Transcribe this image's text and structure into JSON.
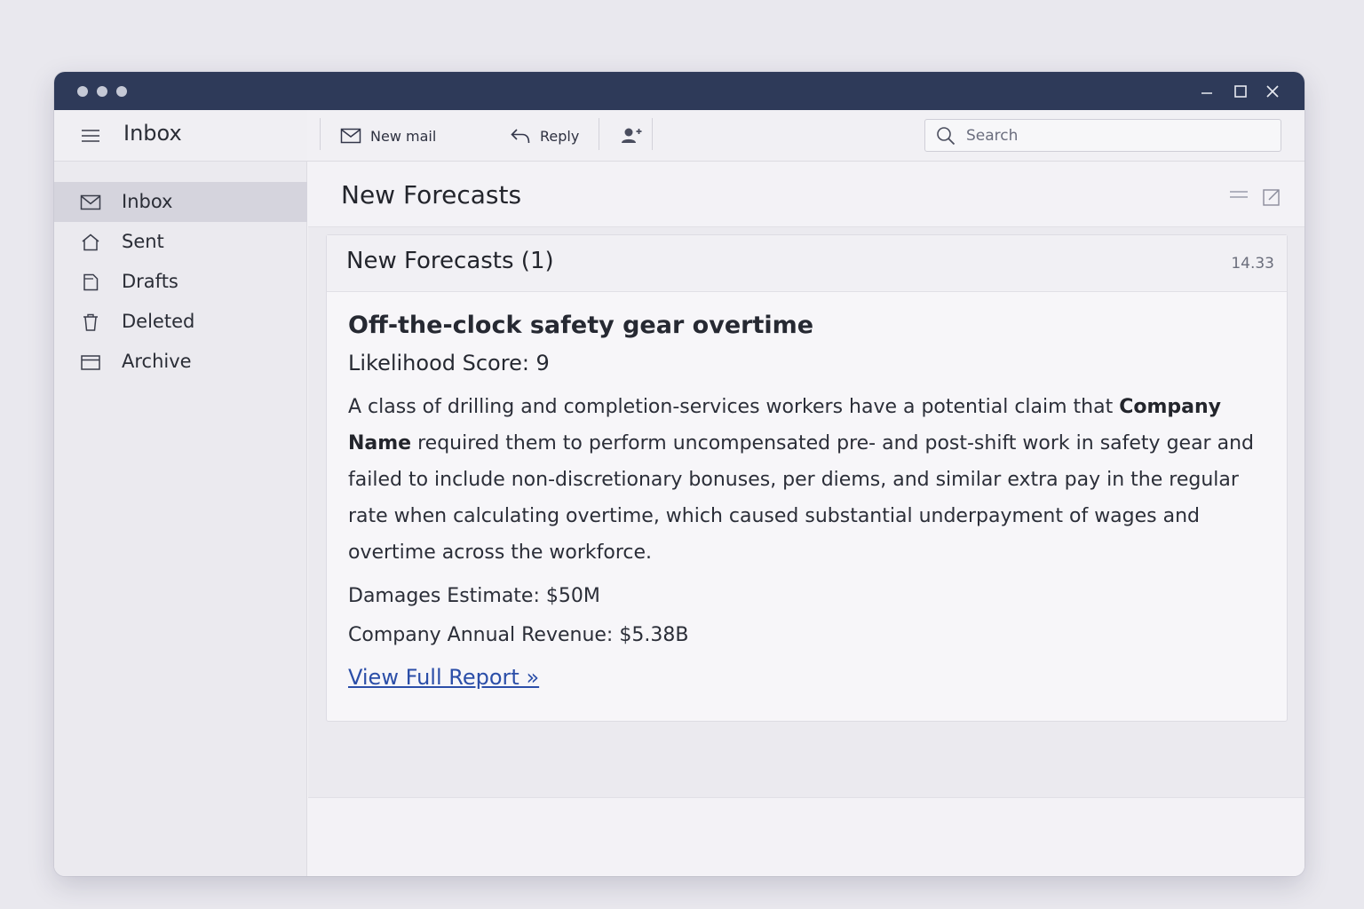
{
  "titlebar": {
    "dots": [
      "dot",
      "dot",
      "dot"
    ],
    "controls": [
      "minimize-icon",
      "maximize-icon",
      "close-icon"
    ]
  },
  "sidebar": {
    "title": "Inbox",
    "items": [
      {
        "label": "Inbox",
        "icon": "envelope-icon",
        "active": true
      },
      {
        "label": "Sent",
        "icon": "home-icon",
        "active": false
      },
      {
        "label": "Drafts",
        "icon": "document-icon",
        "active": false
      },
      {
        "label": "Deleted",
        "icon": "trash-icon",
        "active": false
      },
      {
        "label": "Archive",
        "icon": "archive-icon",
        "active": false
      }
    ]
  },
  "toolbar": {
    "new_mail_label": "New mail",
    "reply_label": "Reply"
  },
  "search": {
    "placeholder": "Search"
  },
  "folder": {
    "title": "New Forecasts"
  },
  "message": {
    "subject": "New Forecasts (1)",
    "time": "14.33",
    "title": "Off-the-clock safety gear overtime",
    "likelihood": "Likelihood Score: 9",
    "para_start": "A class of drilling and completion-services workers have a potential claim that",
    "company": "Company Name",
    "para_rest": "required them to perform uncompensated pre- and post-shift work in safety gear and failed to include non-discretionary bonuses, per diems, and similar extra pay in the regular rate when calculating overtime, which caused substantial underpayment of wages and overtime across the workforce.",
    "damages": "Damages Estimate: $50M",
    "revenue": "Company Annual Revenue: $5.38B",
    "link": "View Full Report »"
  },
  "colors": {
    "titlebar": "#2e3a59",
    "link": "#2b4ea8",
    "active_nav": "#d5d4dd"
  }
}
